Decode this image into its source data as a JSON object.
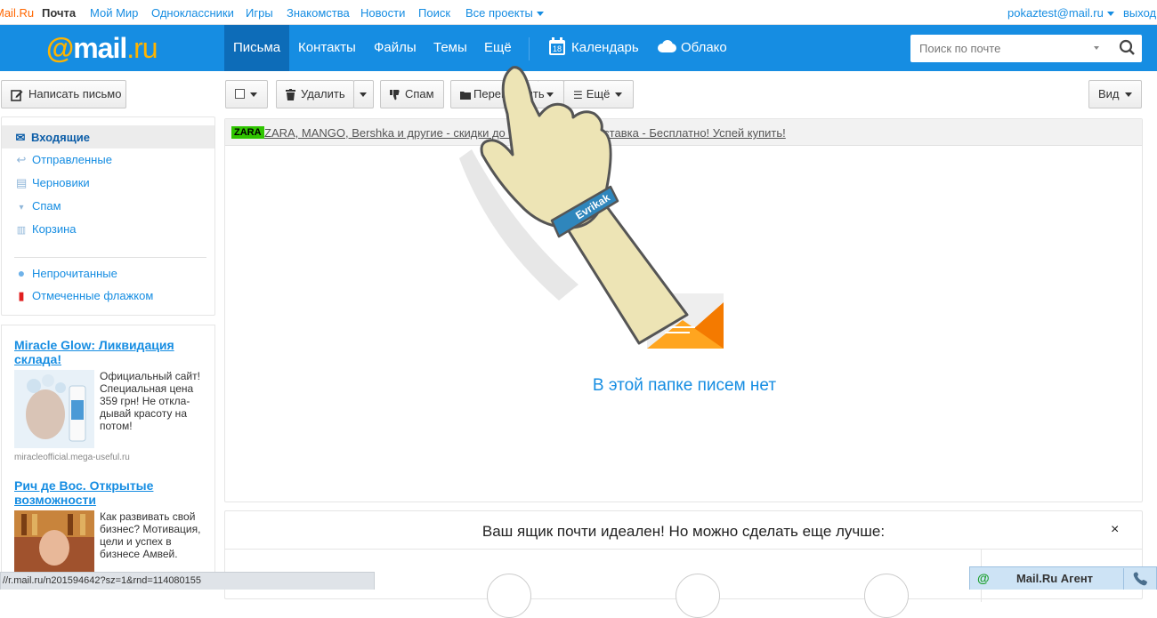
{
  "topbar": {
    "links": [
      {
        "id": "mailru",
        "label": "Mail.Ru"
      },
      {
        "id": "pochta",
        "label": "Почта"
      },
      {
        "id": "moimir",
        "label": "Мой Мир"
      },
      {
        "id": "ok",
        "label": "Одноклассники"
      },
      {
        "id": "igry",
        "label": "Игры"
      },
      {
        "id": "znakomstva",
        "label": "Знакомства"
      },
      {
        "id": "novosti",
        "label": "Новости"
      },
      {
        "id": "poisk",
        "label": "Поиск"
      },
      {
        "id": "projects",
        "label": "Все проекты"
      }
    ],
    "user_email": "pokaztest@mail.ru",
    "logout": "выход"
  },
  "header": {
    "logo_at": "@",
    "logo_main": "mail",
    "logo_dot_ru": ".ru",
    "tabs": [
      {
        "label": "Письма",
        "active": true
      },
      {
        "label": "Контакты"
      },
      {
        "label": "Файлы"
      },
      {
        "label": "Темы"
      },
      {
        "label": "Ещё"
      }
    ],
    "calendar_label": "Календарь",
    "calendar_day": "18",
    "cloud_label": "Облако",
    "search_placeholder": "Поиск по почте"
  },
  "toolbar": {
    "compose": "Написать письмо",
    "delete": "Удалить",
    "spam": "Спам",
    "move": "Переместить",
    "more": "Ещё",
    "view": "Вид"
  },
  "sidebar": {
    "folders": [
      {
        "label": "Входящие",
        "icon": "envelope-icon",
        "active": true
      },
      {
        "label": "Отправленные",
        "icon": "reply-icon"
      },
      {
        "label": "Черновики",
        "icon": "draft-icon"
      },
      {
        "label": "Спам",
        "icon": "thumbs-down-icon"
      },
      {
        "label": "Корзина",
        "icon": "trash-icon"
      }
    ],
    "filters": [
      {
        "label": "Непрочитанные",
        "icon": "dot-icon"
      },
      {
        "label": "Отмеченные флажком",
        "icon": "flag-icon"
      }
    ]
  },
  "ads": [
    {
      "title": "Miracle Glow: Ликвидация склада!",
      "text": "Официальный сайт! Специальная цена 359 грн! Не откла-дывай красоту на потом!",
      "domain": "miracleofficial.mega-useful.ru"
    },
    {
      "title": "Рич де Вос. Открытые возможности",
      "text": "Как развивать свой бизнес? Мотивация, цели и успех в бизнесе Амвей."
    }
  ],
  "promo": {
    "badge": "ZARA",
    "text": "ZARA, MANGO, Bershka и другие - скидки до 75% от 99 грн! Доставка - Бесплатно! Успей купить!"
  },
  "empty_message": "В этой папке писем нет",
  "bottom_panel": {
    "title": "Ваш ящик почти идеален! Но можно сделать еще лучше:",
    "close": "×"
  },
  "hand_overlay": {
    "wristband": "Evrikak"
  },
  "statusbar_url": "//r.mail.ru/n201594642?sz=1&rnd=114080155",
  "agent": {
    "label": "Mail.Ru Агент"
  },
  "colors": {
    "brand_blue": "#168de2",
    "active_tab": "#0d6cb8",
    "logo_accent": "#ffb400",
    "promo_badge": "#2fc500"
  }
}
